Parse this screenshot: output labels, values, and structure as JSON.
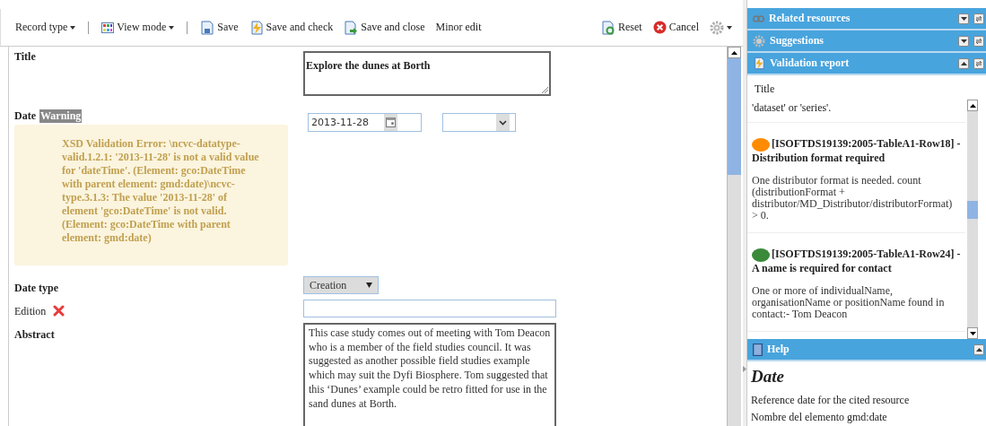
{
  "toolbar": {
    "left": [
      {
        "label": "Record type",
        "menu": true
      },
      {
        "label": "View mode",
        "menu": true
      },
      {
        "label": "Save",
        "menu": false
      },
      {
        "label": "Save and check",
        "menu": false
      },
      {
        "label": "Save and close",
        "menu": false
      },
      {
        "label": "Minor edit",
        "menu": false
      }
    ],
    "right": [
      {
        "label": "Reset",
        "menu": false
      },
      {
        "label": "Cancel",
        "menu": false
      },
      {
        "menu": true
      }
    ]
  },
  "form": {
    "title": {
      "label": "Title",
      "value": "Explore the dunes at Borth"
    },
    "date": {
      "label": "Date",
      "badge": "Warning",
      "error": "XSD Validation Error: \\ncvc-datatype-valid.1.2.1: '2013-11-28' is not a valid value for 'dateTime'. (Element: gco:DateTime with parent element: gmd:date)\\ncvc-type.3.1.3: The value '2013-11-28' of element 'gco:DateTime' is not valid. (Element: gco:DateTime with parent element: gmd:date)",
      "value": "2013-11-28"
    },
    "date_type": {
      "label": "Date type",
      "value": "Creation"
    },
    "edition": {
      "label": "Edition"
    },
    "abstract": {
      "label": "Abstract",
      "lines": [
        "This case study comes out of meeting with Tom Deacon who is a member of the field studies council.  It was suggested as another possible field studies example which may suit the Dyfi Biosphere.  Tom suggested that this ‘Dunes’ example could be retro fitted for use in the sand dunes at Borth."
      ]
    }
  },
  "panels": [
    {
      "title": "Related resources",
      "expanded": false
    },
    {
      "title": "Suggestions",
      "expanded": false
    },
    {
      "title": "Validation report",
      "expanded": true
    }
  ],
  "validation": {
    "heading": "Title",
    "partial": "'dataset' or 'series'.",
    "items": [
      {
        "color": "#ff8c00",
        "title": "[ISOFTDS19139:2005-TableA1-Row18] - Distribution format required",
        "text": "One distributor format is needed. count (distributionFormat + distributor/MD_Distributor/distributorFormat) > 0."
      },
      {
        "color": "#3a8a3a",
        "title": "[ISOFTDS19139:2005-TableA1-Row24] - A name is required for contact",
        "text": "One or more of individualName, organisationName or positionName found in contact:- Tom Deacon"
      }
    ]
  },
  "help": {
    "title": "Help",
    "expanded": true,
    "heading": "Date",
    "lines": [
      "Reference date for the cited resource",
      "Nombre del elemento gmd:date"
    ]
  }
}
